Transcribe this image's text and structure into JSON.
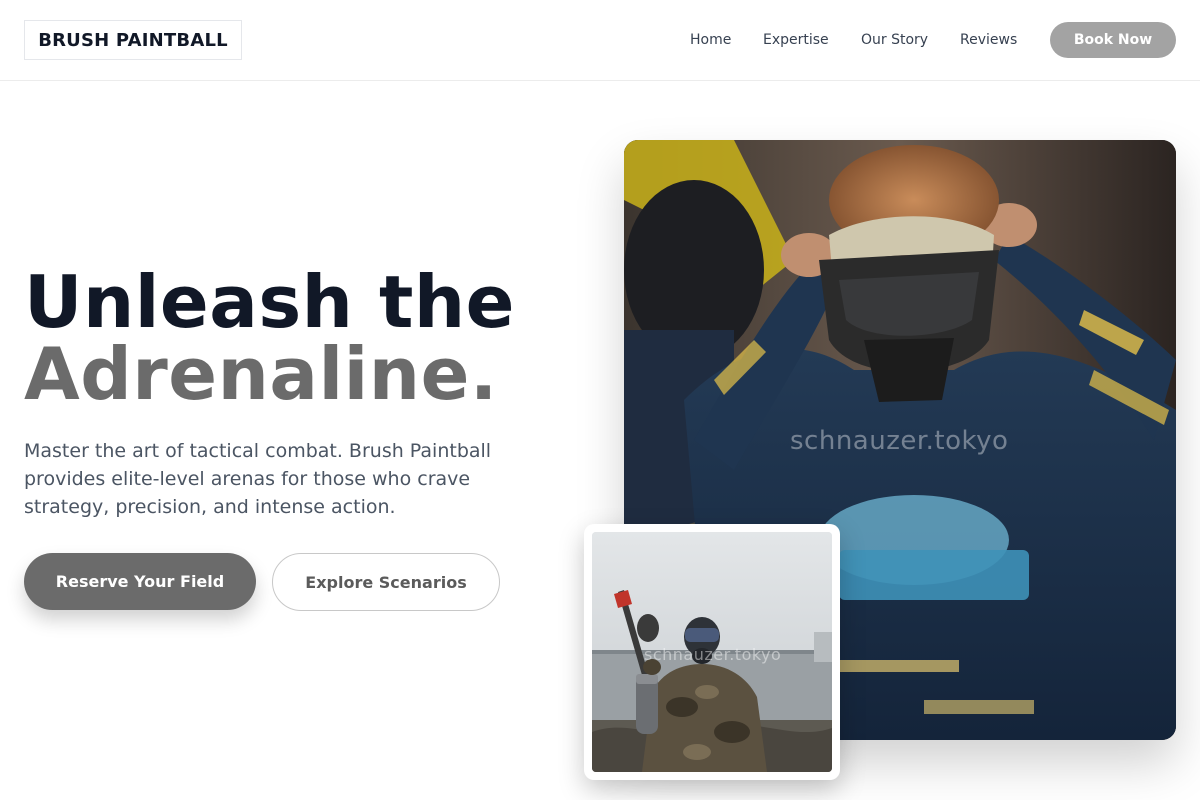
{
  "brand": {
    "name": "BRUSH PAINTBALL"
  },
  "nav": {
    "items": [
      "Home",
      "Expertise",
      "Our Story",
      "Reviews"
    ],
    "cta": "Book Now"
  },
  "hero": {
    "title_line1": "Unleash the",
    "title_line2": "Adrenaline.",
    "subtitle": "Master the art of tactical combat. Brush Paintball provides elite-level arenas for those who crave strategy, precision, and intense action.",
    "primary_button": "Reserve Your Field",
    "secondary_button": "Explore Scenarios"
  },
  "images": {
    "main": {
      "subject": "paintball player adjusting mask",
      "watermark": "schnauzer.tokyo"
    },
    "secondary": {
      "subject": "paintball player holding marker",
      "watermark": "schnauzer.tokyo"
    }
  },
  "colors": {
    "accent_gray": "#6b6b6b",
    "cta_gray": "#a3a3a3",
    "heading_dark": "#111827"
  }
}
